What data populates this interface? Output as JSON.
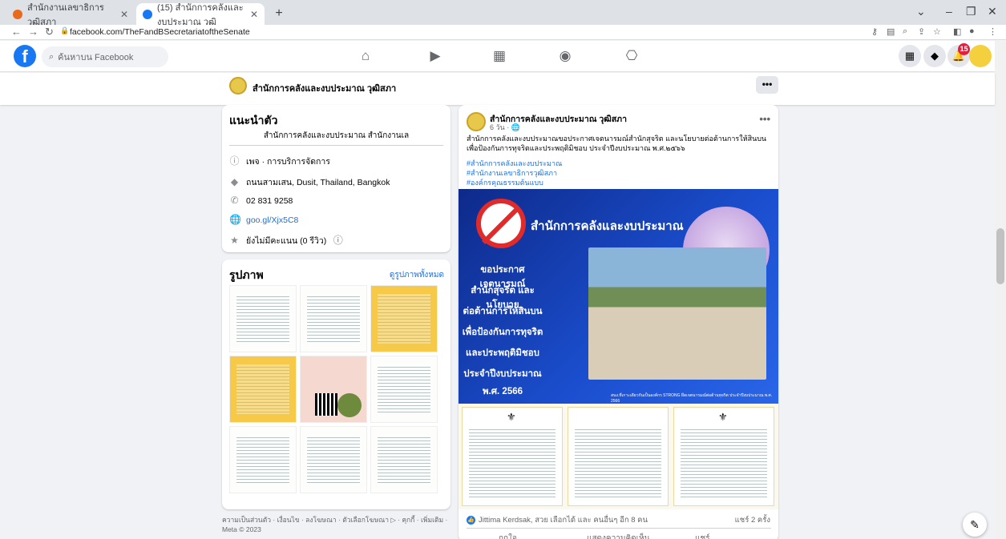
{
  "browser": {
    "tabs": [
      {
        "title": "สำนักงานเลขาธิการวุฒิสภา",
        "icon": "orange-circle-favicon"
      },
      {
        "title": "(15) สำนักการคลังและงบประมาณ วุฒิ",
        "icon": "facebook-favicon"
      }
    ],
    "url": "facebook.com/TheFandBSecretariatoftheSenate"
  },
  "fbnav": {
    "search_placeholder": "ค้นหาบน Facebook",
    "notification_count": "15"
  },
  "page": {
    "name": "สำนักการคลังและงบประมาณ วุฒิสภา",
    "more_label": "•••"
  },
  "intro": {
    "title": "แนะนำตัว",
    "bio": "สำนักการคลังและงบประมาณ สำนักงานเล",
    "category": "เพจ · การบริการจัดการ",
    "address": "ถนนสามเสน, Dusit, Thailand, Bangkok",
    "phone": "02 831 9258",
    "website": "goo.gl/Xjx5C8",
    "rating": "ยังไม่มีคะแนน (0 รีวิว)"
  },
  "photos": {
    "title": "รูปภาพ",
    "see_all": "ดูรูปภาพทั้งหมด"
  },
  "footer": "ความเป็นส่วนตัว · เงื่อนไข · ลงโฆษณา · ตัวเลือกโฆษณา ▷ · คุกกี้ · เพิ่มเติม · Meta © 2023",
  "post": {
    "author": "สำนักการคลังและงบประมาณ วุฒิสภา",
    "time": "6 วัน · 🌐",
    "text": "สำนักการคลังและงบประมาณขอประกาศเจตนารมณ์สำนักสุจริต และนโยบายต่อต้านการให้สินบนเพื่อป้องกันการทุจริตและประพฤติมิชอบ ประจำปีงบประมาณ พ.ศ.๒๕๖๖",
    "tags": [
      "#สำนักการคลังและงบประมาณ",
      "#สำนักงานเลขาธิการวุฒิสภา",
      "#องค์กรคุณธรรมต้นแบบ"
    ],
    "banner_title": "สำนักการคลังและงบประมาณ",
    "banner_lines": [
      "ขอประกาศเจตนารมณ์",
      "สำนักสุจริต และนโยบาย",
      "ต่อต้านการให้สินบน",
      "เพื่อป้องกันการทุจริต",
      "และประพฤติมิชอบ",
      "ประจำปีงบประมาณ",
      "พ.ศ. 2566"
    ],
    "banner_footer": "สนง.ที่เกาะเดียวกันเป็นองค์กร STRONG ยึดเจตนารมณ์ต่อต้านทุจริต ประจำปีงบประมาณ พ.ศ. 2566",
    "reactions": "Jittima Kerdsak, สวย เลือกได้ และ คนอื่นๆ อีก 8 คน",
    "shares": "แชร์ 2 ครั้ง",
    "actions": [
      "ถูกใจ",
      "แสดงความคิดเห็น",
      "แชร์"
    ]
  }
}
